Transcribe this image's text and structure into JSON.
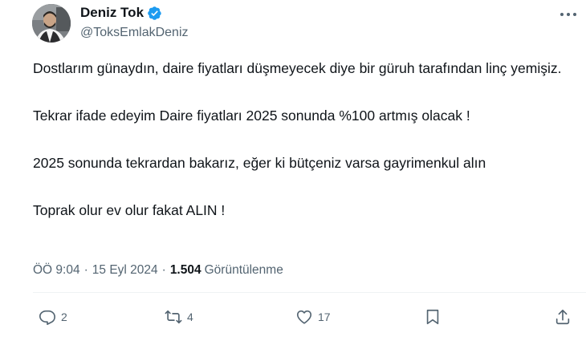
{
  "tweet": {
    "author": {
      "display_name": "Deniz Tok",
      "handle": "@ToksEmlakDeniz",
      "verified": true,
      "verified_color": "#1d9bf0"
    },
    "paragraphs": [
      "Dostlarım günaydın, daire fiyatları düşmeyecek diye bir güruh tarafından linç yemişiz.",
      "Tekrar ifade edeyim Daire fiyatları 2025 sonunda %100 artmış olacak !",
      "2025 sonunda tekrardan bakarız, eğer ki bütçeniz varsa gayrimenkul alın",
      "Toprak olur ev olur fakat ALIN !"
    ],
    "time": "ÖÖ 9:04",
    "date": "15 Eyl 2024",
    "separator": "·",
    "views_count": "1.504",
    "views_label": "Görüntülenme"
  },
  "actions": {
    "reply_count": "2",
    "retweet_count": "4",
    "like_count": "17",
    "reply_icon": "reply-icon",
    "retweet_icon": "retweet-icon",
    "like_icon": "heart-icon",
    "bookmark_icon": "bookmark-icon",
    "share_icon": "share-icon"
  },
  "colors": {
    "text": "#0f1419",
    "secondary": "#536471",
    "divider": "#eff3f4"
  }
}
